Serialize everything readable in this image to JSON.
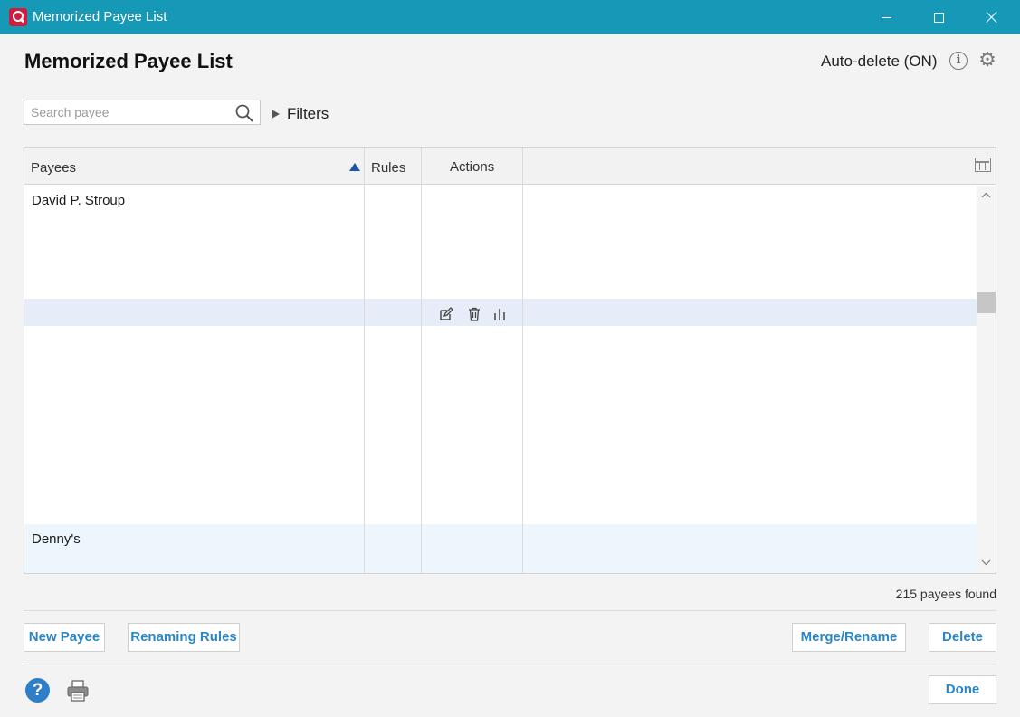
{
  "window": {
    "title": "Memorized Payee List",
    "app_icon": "quicken-icon",
    "controls": [
      "minimize-icon",
      "maximize-icon",
      "close-icon"
    ]
  },
  "header": {
    "title": "Memorized Payee List",
    "auto_delete_label": "Auto-delete (ON)",
    "info_icon": "info-icon",
    "settings_icon": "gear-icon"
  },
  "search": {
    "placeholder": "Search payee",
    "value": "",
    "icon": "search-icon"
  },
  "filters": {
    "label": "Filters",
    "expanded": false
  },
  "table": {
    "columns": {
      "payees": "Payees",
      "rules": "Rules",
      "actions": "Actions"
    },
    "sort": {
      "column": "Payees",
      "direction": "ascending"
    },
    "rows": [
      {
        "payee": "David P. Stroup",
        "rules": ""
      },
      {
        "payee": "",
        "rules": "",
        "highlighted": true,
        "actions": [
          "edit-icon",
          "delete-icon",
          "report-icon"
        ]
      },
      {
        "payee": "",
        "rules": ""
      },
      {
        "payee": "Denny's",
        "rules": ""
      }
    ],
    "column_chooser_icon": "column-chooser-icon"
  },
  "status": {
    "count_text": "215 payees found"
  },
  "buttons": {
    "new_payee": "New Payee",
    "renaming_rules": "Renaming Rules",
    "merge_rename": "Merge/Rename",
    "delete": "Delete",
    "done": "Done"
  },
  "footer": {
    "help_icon": "help-icon",
    "print_icon": "printer-icon"
  },
  "colors": {
    "titlebar": "#1699b6",
    "brand": "#d11b3f",
    "accent_text": "#2a86c7",
    "selected_row": "#e6edf8",
    "alt_row": "#edf5fd"
  }
}
